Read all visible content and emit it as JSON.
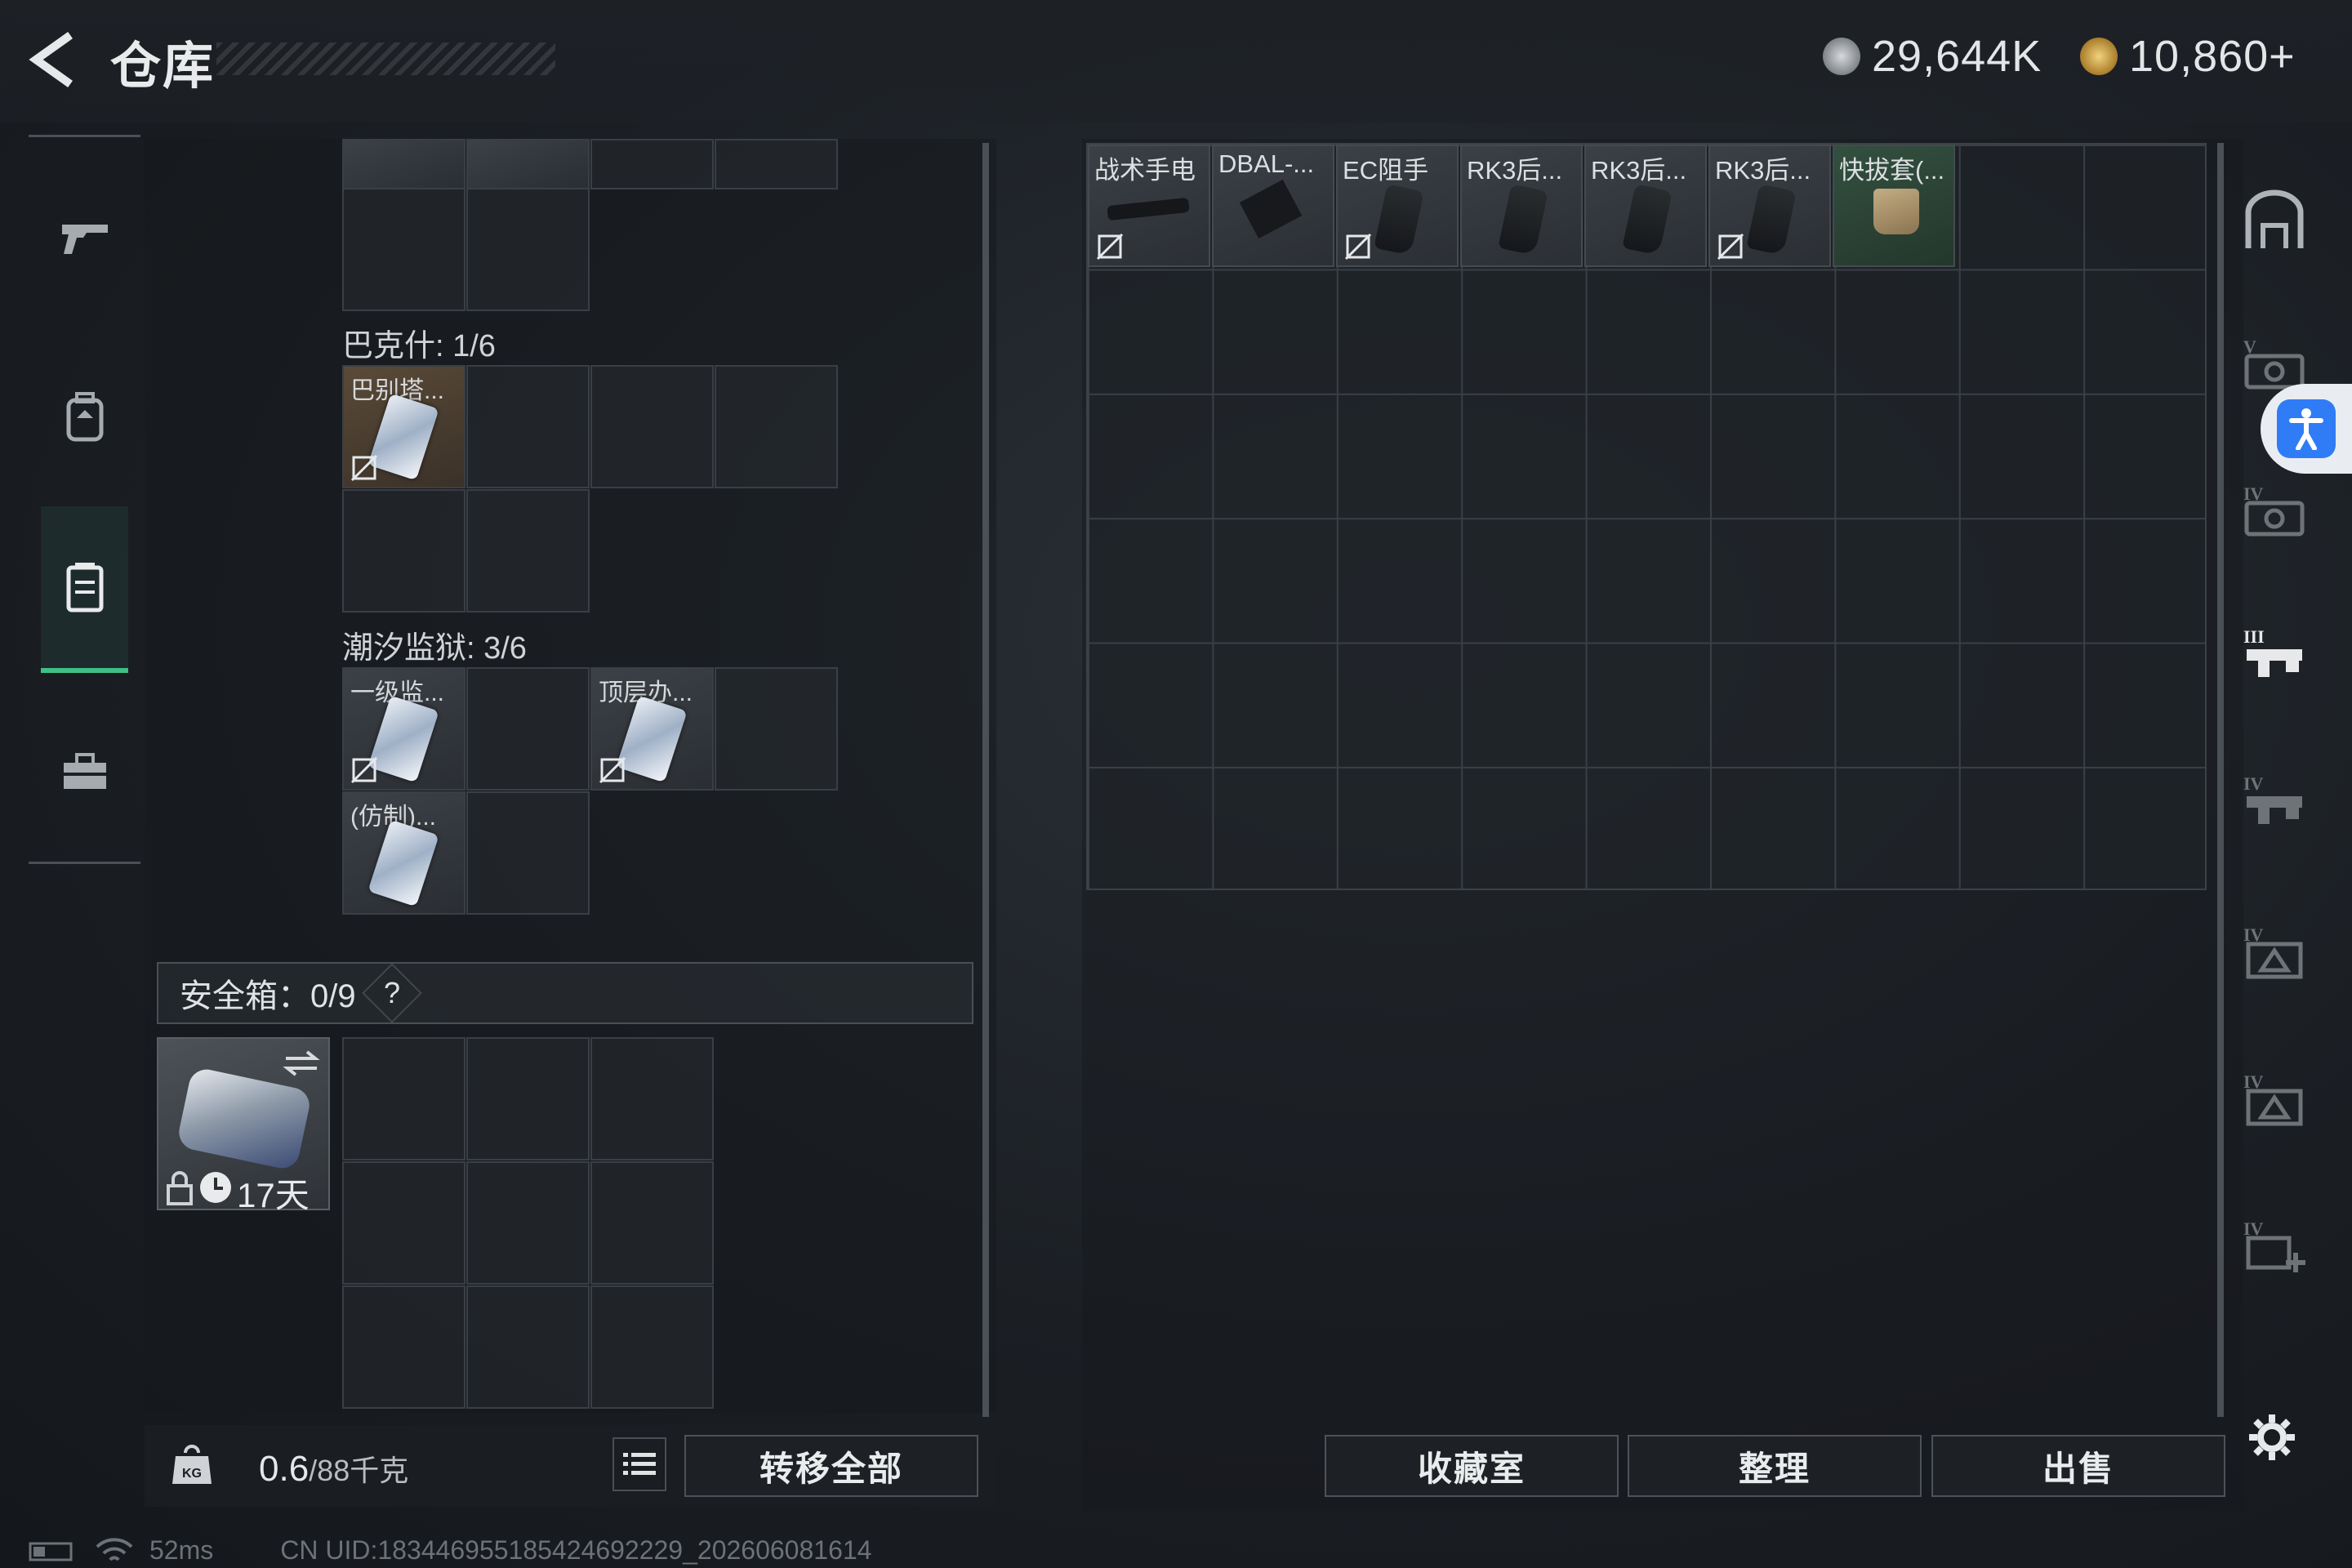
{
  "header": {
    "title": "仓库",
    "currency": [
      {
        "icon": "silver-coin-icon",
        "value": "29,644K"
      },
      {
        "icon": "gold-coin-icon",
        "value": "10,860+"
      }
    ]
  },
  "left_rail": [
    {
      "icon": "gun-icon",
      "active": false
    },
    {
      "icon": "backpack-icon",
      "active": false
    },
    {
      "icon": "vest-icon",
      "active": true
    },
    {
      "icon": "toolbox-icon",
      "active": false
    }
  ],
  "keys_panel": {
    "sections": [
      {
        "label": "巴克什: 1/6",
        "items": [
          "巴别塔..."
        ]
      },
      {
        "label": "潮汐监狱: 3/6",
        "items": [
          "一级监...",
          "顶层办...",
          "(仿制)..."
        ]
      }
    ]
  },
  "safe": {
    "label": "安全箱：0/9",
    "help": "?",
    "days": "17天"
  },
  "bottom": {
    "weight_value": "0.6",
    "weight_max": "/88千克",
    "transfer_all": "转移全部"
  },
  "stash_items": [
    {
      "label": "战术手电",
      "no_trade": true
    },
    {
      "label": "DBAL-...",
      "no_trade": false
    },
    {
      "label": "EC阻手",
      "no_trade": true
    },
    {
      "label": "RK3后...",
      "no_trade": false
    },
    {
      "label": "RK3后...",
      "no_trade": false
    },
    {
      "label": "RK3后...",
      "no_trade": true
    },
    {
      "label": "快拔套(...",
      "no_trade": false
    }
  ],
  "actions": {
    "collection": "收藏室",
    "organize": "整理",
    "sell": "出售"
  },
  "right_tabs": [
    {
      "icon": "armor-tab-icon",
      "tier": ""
    },
    {
      "icon": "ammo-tab-icon",
      "tier": "V"
    },
    {
      "icon": "ammo-tab-icon",
      "tier": "IV"
    },
    {
      "icon": "attachment-tab-icon",
      "tier": "III"
    },
    {
      "icon": "attachment-tab-icon",
      "tier": "IV"
    },
    {
      "icon": "supply-tab-icon",
      "tier": "IV"
    },
    {
      "icon": "supply-tab-icon",
      "tier": "IV"
    },
    {
      "icon": "medical-tab-icon",
      "tier": "IV"
    }
  ],
  "status": {
    "ping": "52ms",
    "uid": "CN UID:183446955185424692229_202606081614"
  },
  "colors": {
    "accent_green": "#3fbf86",
    "accessibility_blue": "#2f7cf6"
  }
}
